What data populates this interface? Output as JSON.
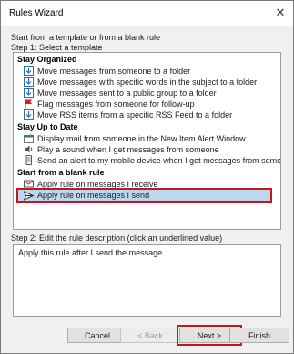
{
  "window": {
    "title": "Rules Wizard",
    "close_symbol": "✕"
  },
  "intro": "Start from a template or from a blank rule",
  "step1": "Step 1: Select a template",
  "groups": [
    {
      "header": "Stay Organized",
      "items": [
        {
          "label": "Move messages from someone to a folder",
          "icon": "move-to-folder-icon"
        },
        {
          "label": "Move messages with specific words in the subject to a folder",
          "icon": "move-to-folder-icon"
        },
        {
          "label": "Move messages sent to a public group to a folder",
          "icon": "move-to-folder-icon"
        },
        {
          "label": "Flag messages from someone for follow-up",
          "icon": "red-flag-icon"
        },
        {
          "label": "Move RSS items from a specific RSS Feed to a folder",
          "icon": "move-to-folder-icon"
        }
      ]
    },
    {
      "header": "Stay Up to Date",
      "items": [
        {
          "label": "Display mail from someone in the New Item Alert Window",
          "icon": "alert-window-icon"
        },
        {
          "label": "Play a sound when I get messages from someone",
          "icon": "speaker-icon"
        },
        {
          "label": "Send an alert to my mobile device when I get messages from someone",
          "icon": "mobile-device-icon"
        }
      ]
    },
    {
      "header": "Start from a blank rule",
      "items": [
        {
          "label": "Apply rule on messages I receive",
          "icon": "envelope-icon"
        },
        {
          "label": "Apply rule on messages I send",
          "icon": "send-arrow-icon",
          "selected": true
        }
      ]
    }
  ],
  "step2": "Step 2: Edit the rule description (click an underlined value)",
  "description": "Apply this rule after I send the message",
  "buttons": {
    "cancel": "Cancel",
    "back": "< Back",
    "next": "Next >",
    "finish": "Finish"
  },
  "colors": {
    "selection": "#bcd7ee",
    "highlight_border": "#c4161c",
    "folder_blue": "#2f6fb0",
    "flag_red": "#d6212b"
  }
}
